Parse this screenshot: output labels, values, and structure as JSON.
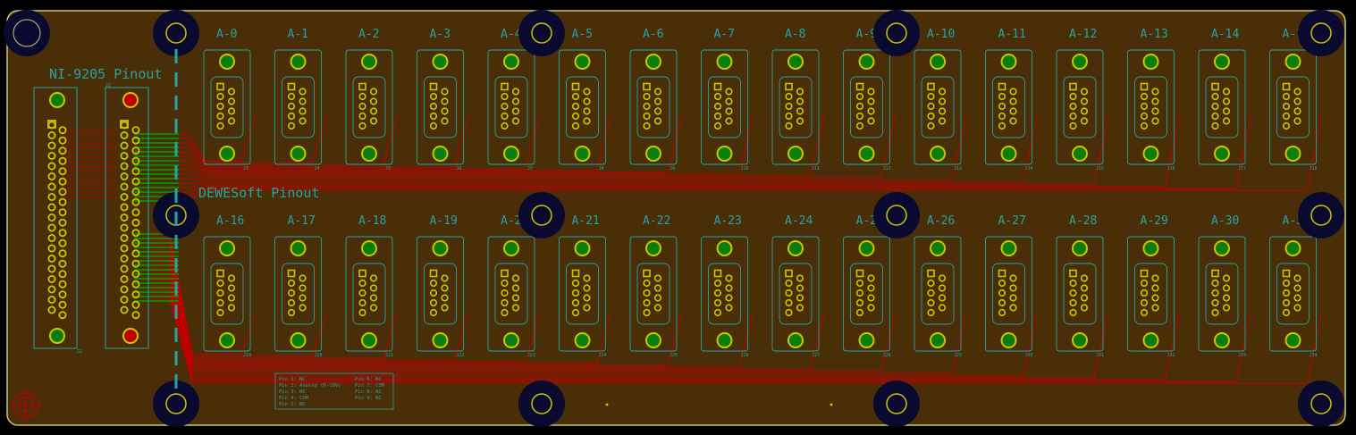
{
  "board": {
    "colors": {
      "background": "#000000",
      "board": "#4a2e08",
      "edge": "#c8c878",
      "silkscreen": "#26a3a3",
      "copper_front": "#c00000",
      "copper_back": "#00a000",
      "pad": "#c8c800",
      "via": "#0a7d0a",
      "mount_hole": "#0a0a30"
    },
    "labels": {
      "ni_title": "NI-9205 Pinout",
      "dewe_title": "DEWESoft Pinout",
      "ni_ref_a": "J1",
      "ni_ref_b": "J2"
    },
    "top_row": {
      "channels": [
        "A-0",
        "A-1",
        "A-2",
        "A-3",
        "A-4",
        "A-5",
        "A-6",
        "A-7",
        "A-8",
        "A-9",
        "A-10",
        "A-11",
        "A-12",
        "A-13",
        "A-14",
        "A-15"
      ],
      "refs": [
        "J3",
        "J4",
        "J5",
        "J6",
        "J7",
        "J8",
        "J9",
        "J10",
        "J11",
        "J12",
        "J13",
        "J14",
        "J15",
        "J16",
        "J17",
        "J18"
      ]
    },
    "bottom_row": {
      "channels": [
        "A-16",
        "A-17",
        "A-18",
        "A-19",
        "A-20",
        "A-21",
        "A-22",
        "A-23",
        "A-24",
        "A-25",
        "A-26",
        "A-27",
        "A-28",
        "A-29",
        "A-30",
        "A-31"
      ],
      "refs": [
        "J19",
        "J20",
        "J21",
        "J22",
        "J23",
        "J24",
        "J25",
        "J26",
        "J27",
        "J28",
        "J29",
        "J30",
        "J31",
        "J32",
        "J33",
        "J34"
      ]
    },
    "pin_legend": {
      "left": [
        "Pin 1: NC",
        "Pin 2: Analog (0-10V)",
        "Pin 3: NC",
        "Pin 4: COM",
        "Pin 5: NC"
      ],
      "right": [
        "Pin 6: NC",
        "Pin 7: COM",
        "Pin 8: NC",
        "Pin 9: NC"
      ]
    }
  }
}
